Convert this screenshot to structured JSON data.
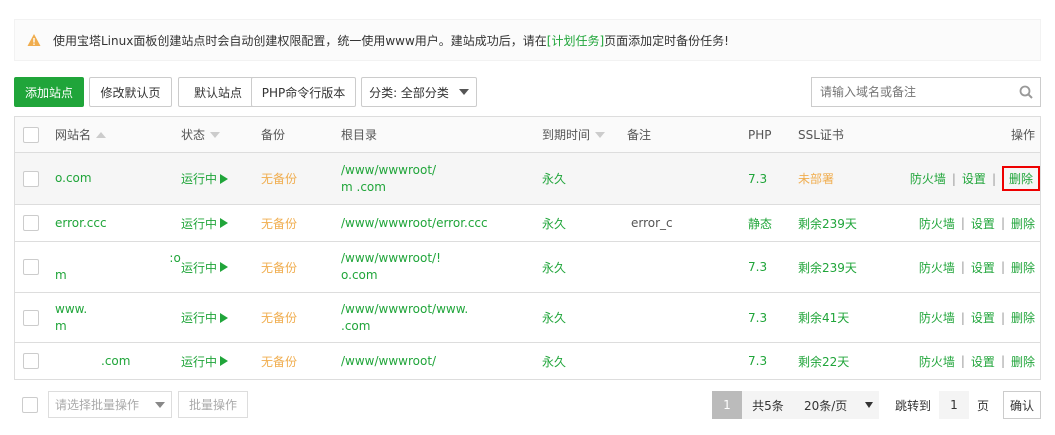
{
  "notice": {
    "text_before": "使用宝塔Linux面板创建站点时会自动创建权限配置，统一使用www用户。建站成功后，请在",
    "link": "[计划任务]",
    "text_after": "页面添加定时备份任务!"
  },
  "toolbar": {
    "add_site": "添加站点",
    "edit_default_page": "修改默认页",
    "default_site": "默认站点",
    "php_cli_version": "PHP命令行版本",
    "category": "分类: 全部分类",
    "search_placeholder": "请输入域名或备注"
  },
  "table": {
    "headers": {
      "name": "网站名",
      "status": "状态",
      "backup": "备份",
      "root": "根目录",
      "expire": "到期时间",
      "remark": "备注",
      "php": "PHP",
      "ssl": "SSL证书",
      "ops": "操作"
    },
    "ops": {
      "firewall": "防火墙",
      "settings": "设置",
      "delete": "删除",
      "sep": "|"
    },
    "rows": [
      {
        "name1": "",
        "name2": "o.com",
        "status": "运行中",
        "backup": "无备份",
        "root1": "/www/wwwroot/",
        "root2": "m        .com",
        "expire": "永久",
        "remark": "",
        "php": "7.3",
        "ssl": "未部署"
      },
      {
        "name1": "error.ccc",
        "name2": "",
        "status": "运行中",
        "backup": "无备份",
        "root1": "/www/wwwroot/error.ccc",
        "root2": "",
        "expire": "永久",
        "remark": "error_c",
        "php": "静态",
        "ssl": "剩余239天"
      },
      {
        "name1": "                              :o",
        "name2": "m",
        "status": "运行中",
        "backup": "无备份",
        "root1": "/www/wwwroot/!",
        "root2": "o.com",
        "expire": "永久",
        "remark": "",
        "php": "7.3",
        "ssl": "剩余239天"
      },
      {
        "name1": "www.",
        "name2": "m",
        "status": "运行中",
        "backup": "无备份",
        "root1": "/www/wwwroot/www.",
        "root2": ".com",
        "expire": "永久",
        "remark": "",
        "php": "7.3",
        "ssl": "剩余41天"
      },
      {
        "name1": ".com",
        "name2": "",
        "status": "运行中",
        "backup": "无备份",
        "root1": "/www/wwwroot/",
        "root2": "",
        "expire": "永久",
        "remark": "",
        "php": "7.3",
        "ssl": "剩余22天"
      }
    ]
  },
  "footer": {
    "batch_placeholder": "请选择批量操作",
    "batch_button": "批量操作",
    "current_page": "1",
    "total": "共5条",
    "page_size": "20条/页",
    "jump_to": "跳转到",
    "jump_value": "1",
    "page_unit": "页",
    "confirm": "确认"
  },
  "colors": {
    "accent": "#20a53a",
    "warning": "#f0ad4e",
    "highlight_border": "#ee0000"
  }
}
